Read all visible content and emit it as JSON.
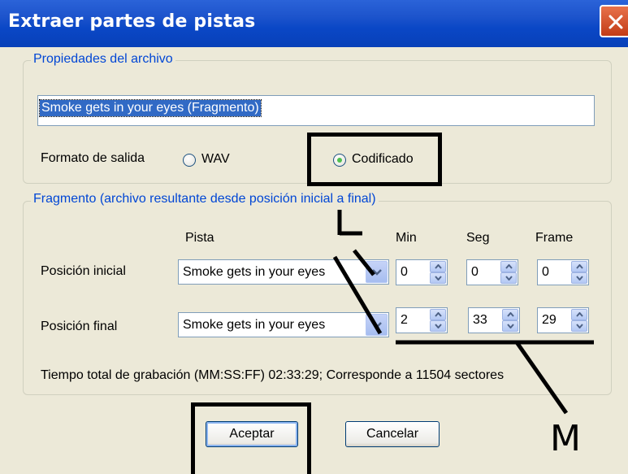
{
  "window": {
    "title": "Extraer partes de pistas",
    "close_icon": "close-x-icon"
  },
  "file_group": {
    "legend": "Propiedades del archivo",
    "filename_value": "Smoke gets in your eyes (Fragmento)",
    "output_format_label": "Formato de salida",
    "radio_wav_label": "WAV",
    "radio_encoded_label": "Codificado",
    "selected_format": "Codificado"
  },
  "fragment_group": {
    "legend": "Fragmento (archivo resultante desde posición inicial a final)",
    "col_track": "Pista",
    "col_min": "Min",
    "col_sec": "Seg",
    "col_frame": "Frame",
    "start": {
      "label": "Posición inicial",
      "track": "Smoke gets in your eyes",
      "min": "0",
      "sec": "0",
      "frame": "0"
    },
    "end": {
      "label": "Posición final",
      "track": "Smoke gets in your eyes",
      "min": "2",
      "sec": "33",
      "frame": "29"
    },
    "total_text": "Tiempo total de grabación (MM:SS:FF) 02:33:29; Corresponde a 11504 sectores"
  },
  "buttons": {
    "ok_label": "Aceptar",
    "cancel_label": "Cancelar"
  },
  "annotations": {
    "mark_l": "L",
    "mark_m": "M"
  }
}
